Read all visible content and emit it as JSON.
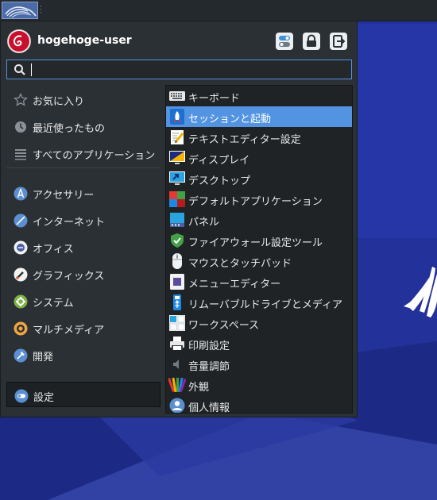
{
  "colors": {
    "accent": "#5294e2",
    "menu_bg": "#2b3034",
    "desktop_bg": "#1d2b7f"
  },
  "panel": {
    "menu_button_icon": "xfce-logo-icon"
  },
  "header": {
    "username": "hogehoge-user",
    "avatar_icon": "debian-swirl-icon",
    "buttons": [
      {
        "icon": "settings-toggle-icon"
      },
      {
        "icon": "lock-icon"
      },
      {
        "icon": "logout-icon"
      }
    ]
  },
  "search": {
    "value": "",
    "placeholder": "",
    "icon": "search-icon"
  },
  "categories": [
    {
      "label": "お気に入り",
      "icon": "star-icon"
    },
    {
      "label": "最近使ったもの",
      "icon": "clock-icon"
    },
    {
      "label": "すべてのアプリケーション",
      "icon": "list-icon"
    },
    {
      "label": "アクセサリー",
      "icon": "compass-icon"
    },
    {
      "label": "インターネット",
      "icon": "globe-icon"
    },
    {
      "label": "オフィス",
      "icon": "office-icon"
    },
    {
      "label": "グラフィックス",
      "icon": "brush-icon"
    },
    {
      "label": "システム",
      "icon": "gear-icon"
    },
    {
      "label": "マルチメディア",
      "icon": "speaker-icon"
    },
    {
      "label": "開発",
      "icon": "hammer-icon"
    },
    {
      "label": "設定",
      "icon": "settings-toggle-icon",
      "active": true
    }
  ],
  "apps": [
    {
      "label": "キーボード",
      "icon": "keyboard-icon"
    },
    {
      "label": "セッションと起動",
      "icon": "rocket-icon",
      "selected": true
    },
    {
      "label": "テキストエディター設定",
      "icon": "text-editor-icon"
    },
    {
      "label": "ディスプレイ",
      "icon": "display-icon"
    },
    {
      "label": "デスクトップ",
      "icon": "desktop-icon"
    },
    {
      "label": "デフォルトアプリケーション",
      "icon": "default-apps-icon"
    },
    {
      "label": "パネル",
      "icon": "panel-icon"
    },
    {
      "label": "ファイアウォール設定ツール",
      "icon": "shield-icon"
    },
    {
      "label": "マウスとタッチパッド",
      "icon": "mouse-icon"
    },
    {
      "label": "メニューエディター",
      "icon": "menu-editor-icon"
    },
    {
      "label": "リムーバブルドライブとメディア",
      "icon": "usb-drive-icon"
    },
    {
      "label": "ワークスペース",
      "icon": "workspaces-icon"
    },
    {
      "label": "印刷設定",
      "icon": "printer-icon"
    },
    {
      "label": "音量調節",
      "icon": "volume-icon"
    },
    {
      "label": "外観",
      "icon": "appearance-icon"
    },
    {
      "label": "個人情報",
      "icon": "user-icon"
    }
  ]
}
